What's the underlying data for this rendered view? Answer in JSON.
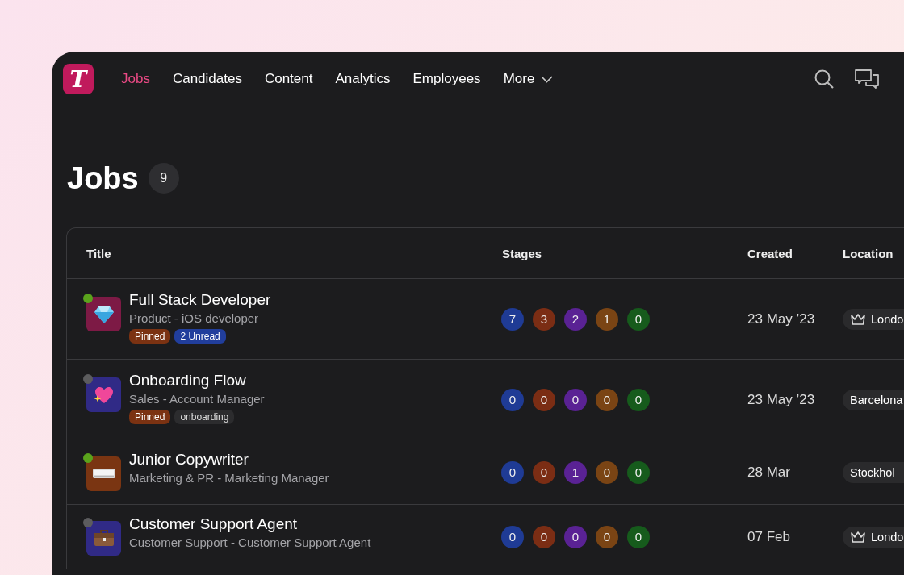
{
  "logo": {
    "letter": "T"
  },
  "nav": [
    {
      "label": "Jobs",
      "selected": true,
      "kind": "link"
    },
    {
      "label": "Candidates",
      "selected": false,
      "kind": "link"
    },
    {
      "label": "Content",
      "selected": false,
      "kind": "link"
    },
    {
      "label": "Analytics",
      "selected": false,
      "kind": "link"
    },
    {
      "label": "Employees",
      "selected": false,
      "kind": "link"
    },
    {
      "label": "More",
      "selected": false,
      "kind": "dropdown"
    }
  ],
  "page": {
    "title": "Jobs",
    "count": "9"
  },
  "table": {
    "columns": [
      "Title",
      "Stages",
      "Created",
      "Location"
    ],
    "rows": [
      {
        "title": "Full Stack Developer",
        "subtitle": "Product - iOS developer",
        "active": true,
        "avatar": {
          "kind": "gem",
          "color": "#7d1a45"
        },
        "tags": [
          {
            "label": "Pinned",
            "kind": "pinned"
          },
          {
            "label": "2 Unread",
            "kind": "unread"
          }
        ],
        "stages": [
          {
            "count": "7",
            "color": "#1f3b95"
          },
          {
            "count": "3",
            "color": "#7b2d14"
          },
          {
            "count": "2",
            "color": "#5a2294"
          },
          {
            "count": "1",
            "color": "#7a4414"
          },
          {
            "count": "0",
            "color": "#165b1c"
          }
        ],
        "created": "23 May ’23",
        "location": {
          "name": "Londo",
          "premium": true
        }
      },
      {
        "title": "Onboarding Flow",
        "subtitle": "Sales - Account Manager",
        "active": false,
        "avatar": {
          "kind": "heart",
          "color": "#302a86"
        },
        "tags": [
          {
            "label": "Pinned",
            "kind": "pinned"
          },
          {
            "label": "onboarding",
            "kind": "plain"
          }
        ],
        "stages": [
          {
            "count": "0",
            "color": "#1f3b95"
          },
          {
            "count": "0",
            "color": "#7b2d14"
          },
          {
            "count": "0",
            "color": "#5a2294"
          },
          {
            "count": "0",
            "color": "#7a4414"
          },
          {
            "count": "0",
            "color": "#165b1c"
          }
        ],
        "created": "23 May ’23",
        "location": {
          "name": "Barcelona",
          "premium": false
        }
      },
      {
        "title": "Junior Copywriter",
        "subtitle": "Marketing & PR - Marketing Manager",
        "active": true,
        "avatar": {
          "kind": "keyboard",
          "color": "#7a3512"
        },
        "stages": [
          {
            "count": "0",
            "color": "#1f3b95"
          },
          {
            "count": "0",
            "color": "#7b2d14"
          },
          {
            "count": "1",
            "color": "#5a2294"
          },
          {
            "count": "0",
            "color": "#7a4414"
          },
          {
            "count": "0",
            "color": "#165b1c"
          }
        ],
        "created": "28 Mar",
        "location": {
          "name": "Stockhol",
          "premium": false
        }
      },
      {
        "title": "Customer Support Agent",
        "subtitle": "Customer Support - Customer Support Agent",
        "active": false,
        "avatar": {
          "kind": "briefcase",
          "color": "#302a86"
        },
        "stages": [
          {
            "count": "0",
            "color": "#1f3b95"
          },
          {
            "count": "0",
            "color": "#7b2d14"
          },
          {
            "count": "0",
            "color": "#5a2294"
          },
          {
            "count": "0",
            "color": "#7a4414"
          },
          {
            "count": "0",
            "color": "#165b1c"
          }
        ],
        "created": "07 Feb",
        "location": {
          "name": "Londo",
          "premium": true
        }
      }
    ]
  }
}
